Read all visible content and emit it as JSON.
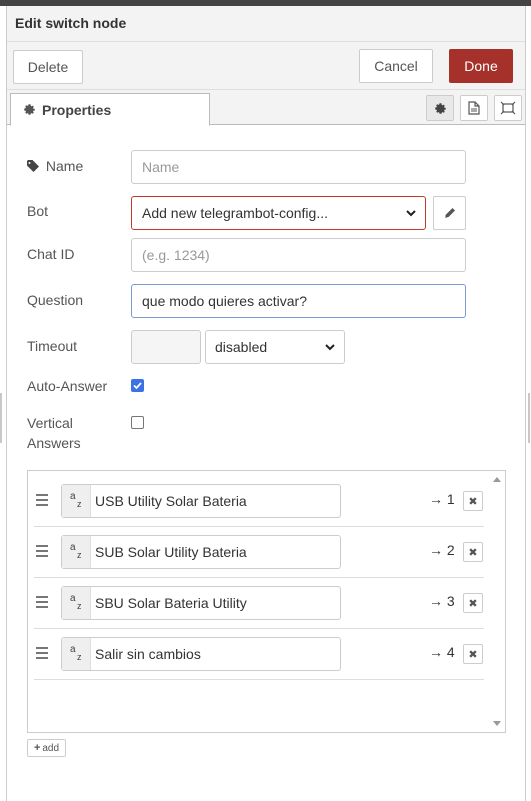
{
  "header": {
    "title": "Edit switch node"
  },
  "toolbar": {
    "delete_label": "Delete",
    "cancel_label": "Cancel",
    "done_label": "Done"
  },
  "tabs": {
    "properties_label": "Properties"
  },
  "form": {
    "name_label": "Name",
    "name_placeholder": "Name",
    "bot_label": "Bot",
    "bot_value": "Add new telegrambot-config...",
    "chatid_label": "Chat ID",
    "chatid_placeholder": "(e.g. 1234)",
    "question_label": "Question",
    "question_value": "que modo quieres activar?",
    "timeout_label": "Timeout",
    "timeout_unit_value": "disabled",
    "autoanswer_label": "Auto-Answer",
    "autoanswer_checked": true,
    "vertical_label_line1": "Vertical",
    "vertical_label_line2": "Answers",
    "vertical_checked": false
  },
  "rules": [
    {
      "text": "USB Utility Solar Bateria",
      "port": "→ 1"
    },
    {
      "text": "SUB Solar Utility Bateria",
      "port": "→ 2"
    },
    {
      "text": "SBU Solar Bateria Utility",
      "port": "→ 3"
    },
    {
      "text": "Salir sin cambios",
      "port": "→ 4"
    }
  ],
  "add_label": "add",
  "colors": {
    "done_bg": "#a6302a",
    "checkbox_accent": "#3b73e6",
    "bot_border": "#c0392b",
    "focus_border": "#7b9bd1"
  }
}
